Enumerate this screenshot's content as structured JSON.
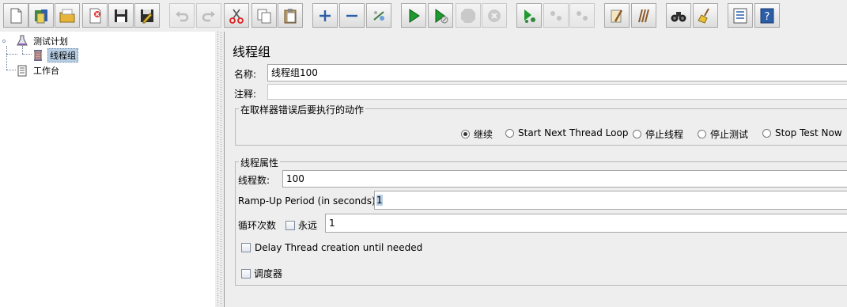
{
  "toolbar": {
    "buttons": [
      {
        "icon": "new-file-icon",
        "enabled": true
      },
      {
        "icon": "templates-icon",
        "enabled": true
      },
      {
        "icon": "open-folder-icon",
        "enabled": true
      },
      {
        "icon": "close-icon",
        "enabled": true
      },
      {
        "icon": "save-icon",
        "enabled": true
      },
      {
        "icon": "save-as-icon",
        "enabled": true
      },
      {
        "icon": "undo-icon",
        "enabled": false
      },
      {
        "icon": "redo-icon",
        "enabled": false
      },
      {
        "icon": "cut-icon",
        "enabled": true
      },
      {
        "icon": "copy-icon",
        "enabled": true
      },
      {
        "icon": "paste-icon",
        "enabled": true
      },
      {
        "icon": "expand-icon",
        "enabled": true
      },
      {
        "icon": "collapse-icon",
        "enabled": true
      },
      {
        "icon": "toggle-icon",
        "enabled": true
      },
      {
        "icon": "start-icon",
        "enabled": true
      },
      {
        "icon": "start-no-pauses-icon",
        "enabled": true
      },
      {
        "icon": "stop-icon",
        "enabled": false
      },
      {
        "icon": "shutdown-icon",
        "enabled": false
      },
      {
        "icon": "remote-start-icon",
        "enabled": true
      },
      {
        "icon": "remote-stop-icon",
        "enabled": false
      },
      {
        "icon": "remote-shutdown-icon",
        "enabled": false
      },
      {
        "icon": "clear-icon",
        "enabled": true
      },
      {
        "icon": "clear-all-icon",
        "enabled": true
      },
      {
        "icon": "search-binoculars-icon",
        "enabled": true
      },
      {
        "icon": "reset-search-broom-icon",
        "enabled": true
      },
      {
        "icon": "function-helper-icon",
        "enabled": true
      },
      {
        "icon": "help-icon",
        "enabled": true
      }
    ]
  },
  "tree": {
    "test_plan": "测试计划",
    "thread_group": "线程组",
    "workbench": "工作台"
  },
  "panel": {
    "title": "线程组",
    "name_label": "名称:",
    "name_value": "线程组100",
    "comment_label": "注释:",
    "comment_value": "",
    "error_action": {
      "title": "在取样器错误后要执行的动作",
      "options": [
        "继续",
        "Start Next Thread Loop",
        "停止线程",
        "停止测试",
        "Stop Test Now"
      ],
      "selected": "继续"
    },
    "thread_props": {
      "title": "线程属性",
      "threads_label": "线程数:",
      "threads_value": "100",
      "rampup_label": "Ramp-Up Period (in seconds):",
      "rampup_value": "1",
      "loop_label": "循环次数",
      "forever_label": "永远",
      "forever_checked": false,
      "loop_value": "1",
      "delay_label": "Delay Thread creation until needed",
      "delay_checked": false,
      "scheduler_label": "调度器",
      "scheduler_checked": false
    }
  }
}
